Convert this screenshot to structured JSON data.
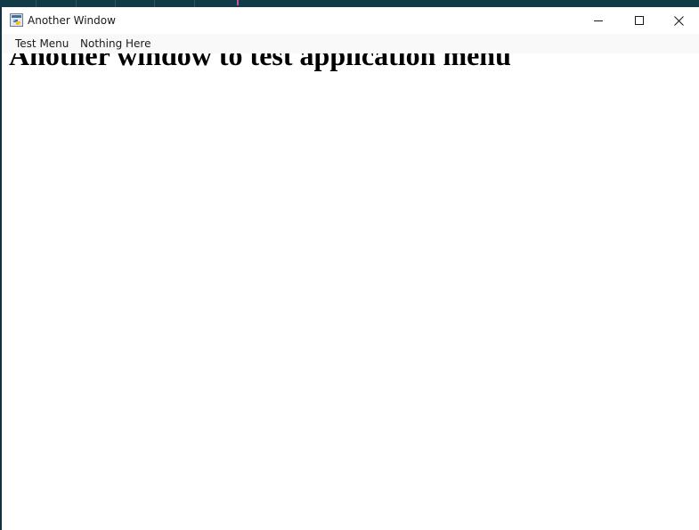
{
  "window": {
    "title": "Another Window",
    "icon": "python-icon"
  },
  "title_buttons": {
    "minimize_icon": "minimize-icon",
    "maximize_icon": "maximize-icon",
    "close_icon": "close-icon"
  },
  "menubar": {
    "items": [
      {
        "label": "Test Menu"
      },
      {
        "label": "Nothing Here"
      }
    ]
  },
  "content": {
    "heading": "Another window to test application menu"
  },
  "colors": {
    "desktop": "#0f3340",
    "window_bg": "#ffffff",
    "menubar_bg": "#f9f9f9",
    "text": "#000000"
  }
}
